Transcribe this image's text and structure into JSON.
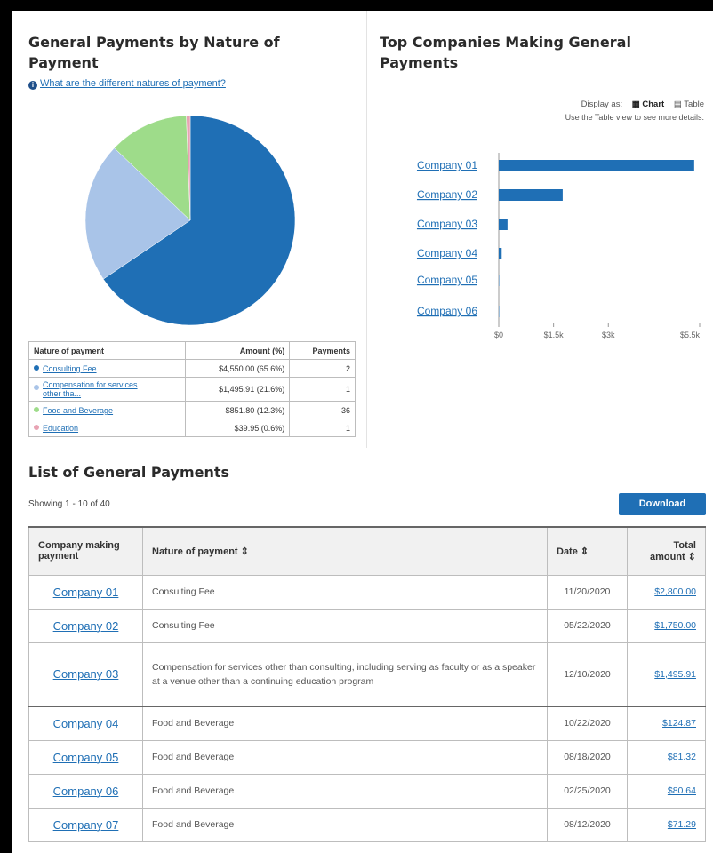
{
  "left_panel": {
    "title": "General Payments by Nature of Payment",
    "info_link": "What are the different natures of payment?",
    "table": {
      "headers": [
        "Nature of payment",
        "Amount (%)",
        "Payments"
      ],
      "rows": [
        {
          "label": "Consulting Fee",
          "amount": "$4,550.00 (65.6%)",
          "payments": "2",
          "color": "#1f6fb5"
        },
        {
          "label": "Compensation for services other tha...",
          "amount": "$1,495.91 (21.6%)",
          "payments": "1",
          "color": "#a9c4e8"
        },
        {
          "label": "Food and Beverage",
          "amount": "$851.80 (12.3%)",
          "payments": "36",
          "color": "#9edc8a"
        },
        {
          "label": "Education",
          "amount": "$39.95 (0.6%)",
          "payments": "1",
          "color": "#e8a3b3"
        }
      ]
    }
  },
  "right_panel": {
    "title": "Top Companies Making General Payments",
    "display_label": "Display as:",
    "chart_option": "Chart",
    "table_option": "Table",
    "note": "Use the Table view to see more details."
  },
  "chart_data": [
    {
      "type": "pie",
      "labels": [
        "Consulting Fee",
        "Compensation for services other tha...",
        "Food and Beverage",
        "Education"
      ],
      "values": [
        65.6,
        21.6,
        12.3,
        0.6
      ],
      "colors": [
        "#1f6fb5",
        "#a9c4e8",
        "#9edc8a",
        "#e8a3b3"
      ]
    },
    {
      "type": "bar",
      "orientation": "horizontal",
      "categories": [
        "Company 01",
        "Company 02",
        "Company 03",
        "Company 04",
        "Company 05",
        "Company 06"
      ],
      "values": [
        5350,
        1750,
        240,
        80,
        10,
        10
      ],
      "xticks": [
        "$0",
        "$1.5k",
        "$3k",
        "$5.5k"
      ],
      "xtick_values": [
        0,
        1500,
        3000,
        5500
      ],
      "xlim": [
        0,
        5500
      ],
      "color": "#1f6fb5"
    }
  ],
  "list": {
    "title": "List of General Payments",
    "showing": "Showing 1 - 10 of 40",
    "download": "Download",
    "headers": {
      "company": "Company making payment",
      "nature": "Nature of payment ⇕",
      "date": "Date ⇕",
      "total": "Total amount ⇕"
    },
    "rows": [
      {
        "company": "Company 01",
        "nature": "Consulting Fee",
        "date": "11/20/2020",
        "amount": "$2,800.00"
      },
      {
        "company": "Company 02",
        "nature": "Consulting Fee",
        "date": "05/22/2020",
        "amount": "$1,750.00"
      },
      {
        "company": "Company 03",
        "nature": "Compensation for services other than consulting, including serving as faculty or as a speaker at a venue other than a continuing education program",
        "date": "12/10/2020",
        "amount": "$1,495.91"
      },
      {
        "company": "Company 04",
        "nature": "Food and Beverage",
        "date": "10/22/2020",
        "amount": "$124.87"
      },
      {
        "company": "Company 05",
        "nature": "Food and Beverage",
        "date": "08/18/2020",
        "amount": "$81.32"
      },
      {
        "company": "Company 06",
        "nature": "Food and Beverage",
        "date": "02/25/2020",
        "amount": "$80.64"
      },
      {
        "company": "Company 07",
        "nature": "Food and Beverage",
        "date": "08/12/2020",
        "amount": "$71.29"
      }
    ]
  }
}
